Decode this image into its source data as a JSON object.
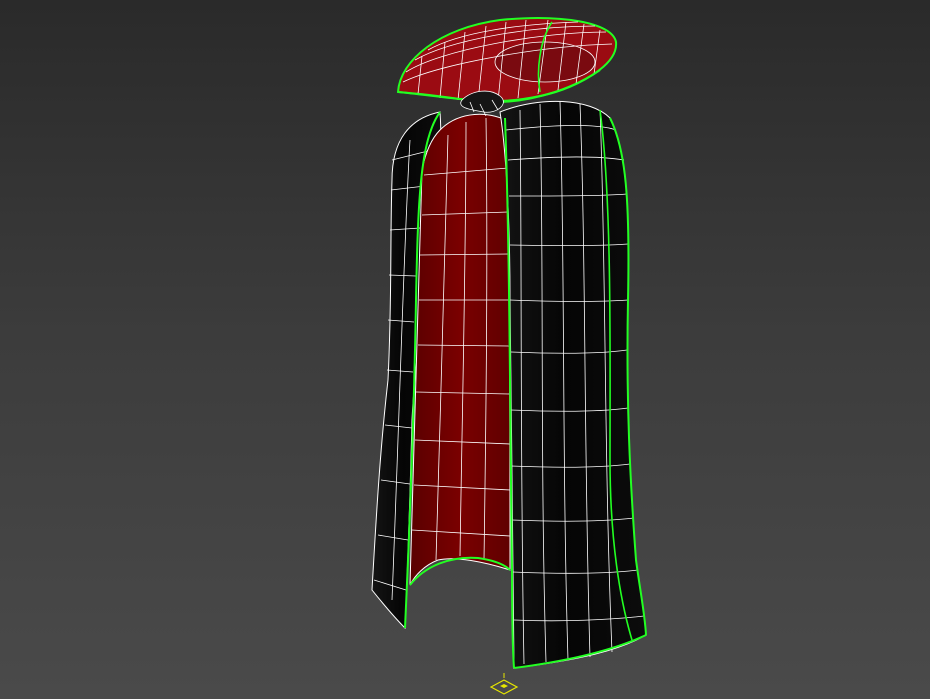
{
  "viewport": {
    "background_top": "#2a2a2a",
    "background_bottom": "#4a4a4a",
    "shading": "wireframe-on-smooth"
  },
  "model": {
    "object": "cape",
    "selected": true,
    "colors": {
      "outer_fabric": "#050505",
      "inner_lining": "#7a0000",
      "inner_lining_shadow": "#5a0000",
      "collar": "#9b0b12",
      "wire": "#ffffff",
      "selection_edge": "#22ff22"
    }
  },
  "pivot_gizmo": {
    "icon": "pivot-gizmo-icon",
    "color": "#e6e600"
  }
}
